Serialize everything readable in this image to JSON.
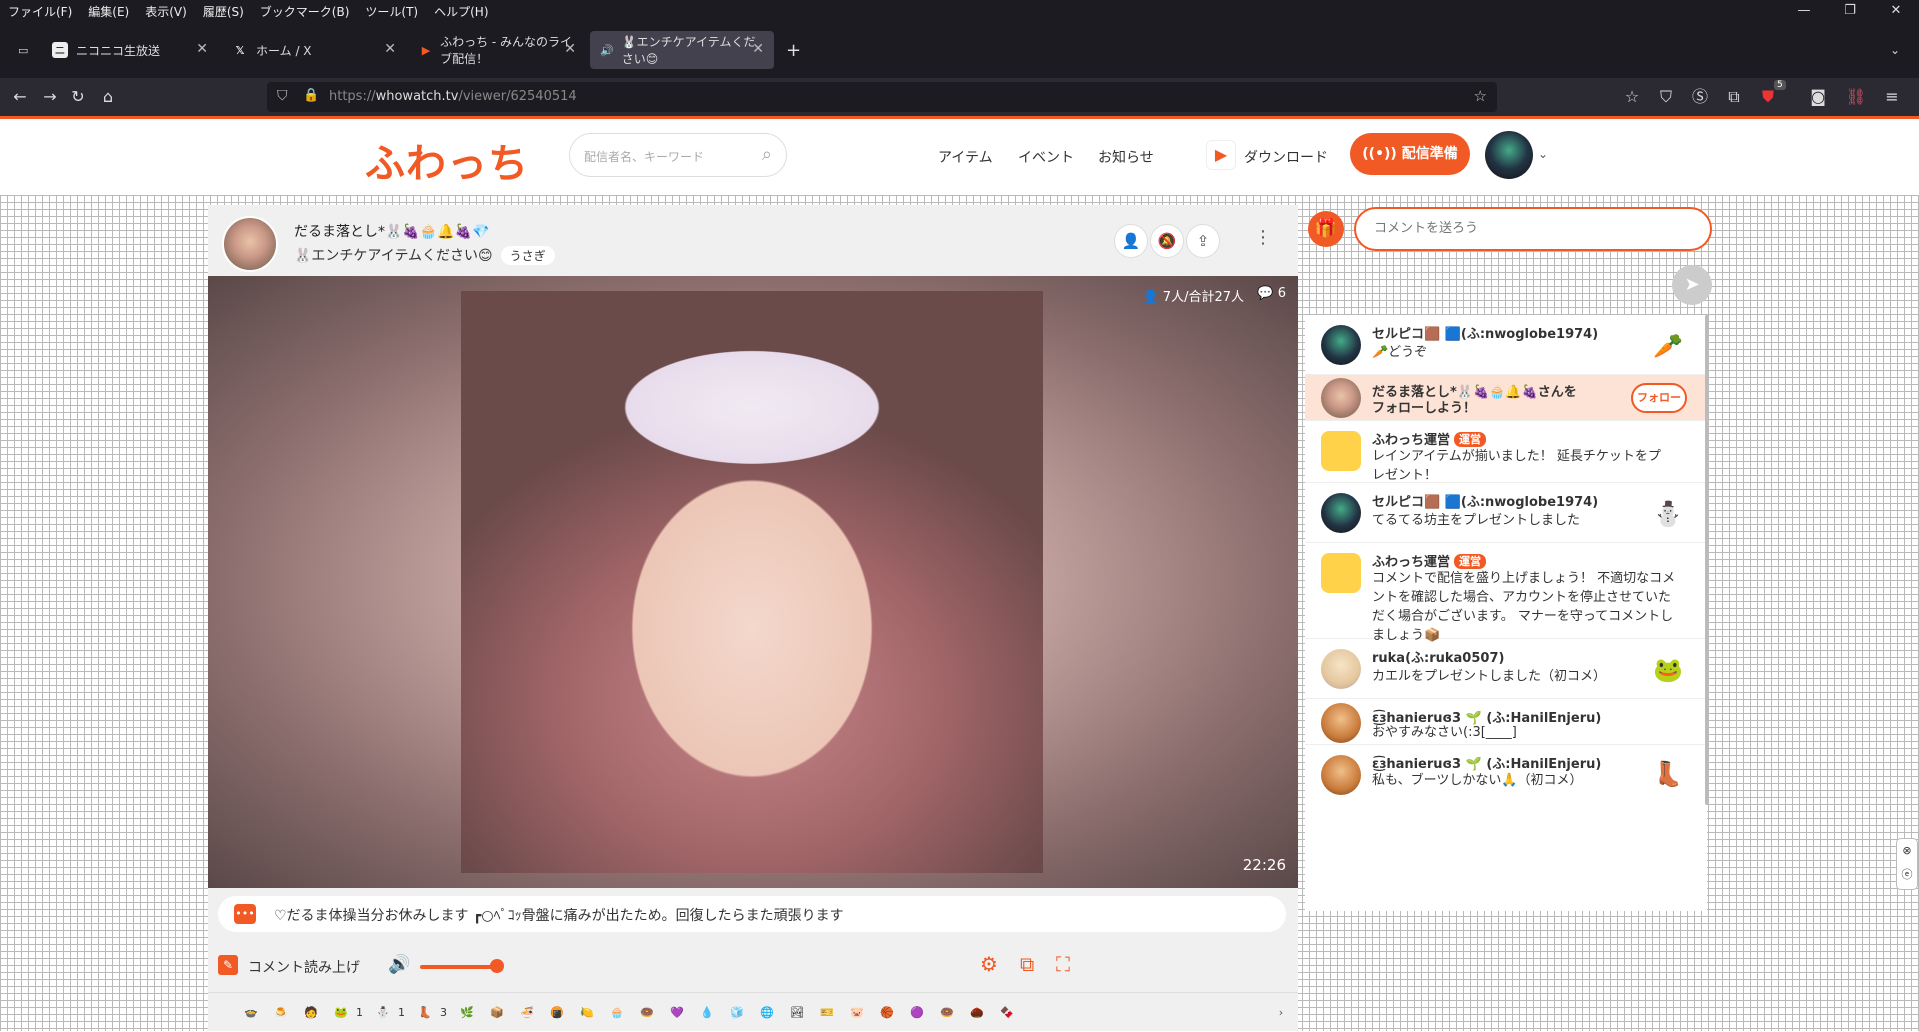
{
  "browser": {
    "menu": [
      "ファイル(F)",
      "編集(E)",
      "表示(V)",
      "履歴(S)",
      "ブックマーク(B)",
      "ツール(T)",
      "ヘルプ(H)"
    ],
    "tabs": [
      {
        "label": "ニコニコ生放送"
      },
      {
        "label": "ホーム / X"
      },
      {
        "label": "ふわっち - みんなのライブ配信！"
      },
      {
        "label": "🐰エンチケアイテムください😊"
      }
    ],
    "url_prefix": "https://",
    "url_domain": "whowatch.tv",
    "url_path": "/viewer/62540514",
    "ext_badge": "5"
  },
  "header": {
    "logo": "ふわっち",
    "search_placeholder": "配信者名、キーワード",
    "nav": [
      "アイテム",
      "イベント",
      "お知らせ"
    ],
    "download": "ダウンロード",
    "broadcast": "配信準備"
  },
  "stream": {
    "broadcaster_name": "だるま落とし*🐰🍇🧁🔔🍇💎",
    "title": "🐰エンチケアイテムください😊",
    "tag": "うさぎ",
    "viewers": "7人/合計27人",
    "comment_count": "6",
    "elapsed": "22:26",
    "notice": "♡だるま体操当分お休みします ┏○ﾍﾟｺｯ骨盤に痛みが出たため。回復したらまた頑張ります",
    "read_aloud": "コメント読み上げ",
    "volume": 0.85
  },
  "items": [
    {
      "icon": "🍲",
      "count": ""
    },
    {
      "icon": "🍮",
      "count": ""
    },
    {
      "icon": "🧑",
      "count": ""
    },
    {
      "icon": "🐸",
      "count": "1"
    },
    {
      "icon": "⛄",
      "count": "1"
    },
    {
      "icon": "👢",
      "count": "3"
    },
    {
      "icon": "🌿",
      "count": ""
    },
    {
      "icon": "📦",
      "count": ""
    },
    {
      "icon": "🍜",
      "count": ""
    },
    {
      "icon": "🍘",
      "count": ""
    },
    {
      "icon": "🍋",
      "count": ""
    },
    {
      "icon": "🧁",
      "count": ""
    },
    {
      "icon": "🍩",
      "count": ""
    },
    {
      "icon": "💜",
      "count": ""
    },
    {
      "icon": "💧",
      "count": ""
    },
    {
      "icon": "🧊",
      "count": ""
    },
    {
      "icon": "🌐",
      "count": ""
    },
    {
      "icon": "🏞",
      "count": ""
    },
    {
      "icon": "🎫",
      "count": ""
    },
    {
      "icon": "🐷",
      "count": ""
    },
    {
      "icon": "🏀",
      "count": ""
    },
    {
      "icon": "🟣",
      "count": ""
    },
    {
      "icon": "🍩",
      "count": ""
    },
    {
      "icon": "🌰",
      "count": ""
    },
    {
      "icon": "🍫",
      "count": ""
    }
  ],
  "comments": {
    "placeholder": "コメントを送ろう",
    "follow_label": "フォロー",
    "official_badge": "運営",
    "rows": [
      {
        "name": "セルピコ🟫 🟦(ふ:nwoglobe1974)",
        "text": "🥕どうぞ",
        "gift": "🥕"
      },
      {
        "name": "だるま落とし*🐰🍇🧁🔔🍇さんを",
        "text": "フォローしよう！",
        "follow": true
      },
      {
        "name": "ふわっち運営",
        "text": "レインアイテムが揃いました！ 延長チケットをプレゼント！",
        "official": true
      },
      {
        "name": "セルピコ🟫 🟦(ふ:nwoglobe1974)",
        "text": "てるてる坊主をプレゼントしました",
        "gift": "⛄"
      },
      {
        "name": "ふわっち運営",
        "text": "コメントで配信を盛り上げましょう！ 不適切なコメントを確認した場合、アカウントを停止させていただく場合がございます。 マナーを守ってコメントしましょう📦",
        "official": true
      },
      {
        "name": "ruka(ふ:ruka0507)",
        "text": "カエルをプレゼントしました（初コメ）",
        "gift": "🐸"
      },
      {
        "name": "ɛ͜͡ɜhanieruɞ3 🌱 (ふ:HanilEnjeru)",
        "text": "おやすみなさい(:3[____]"
      },
      {
        "name": "ɛ͜͡ɜhanieruɞ3 🌱 (ふ:HanilEnjeru)",
        "text": "私も、ブーツしかない🙏（初コメ）",
        "gift": "👢"
      }
    ]
  },
  "colors": {
    "accent": "#f15a24",
    "chrome_dark": "#1c1b22",
    "follow_highlight": "#fde2d6"
  }
}
